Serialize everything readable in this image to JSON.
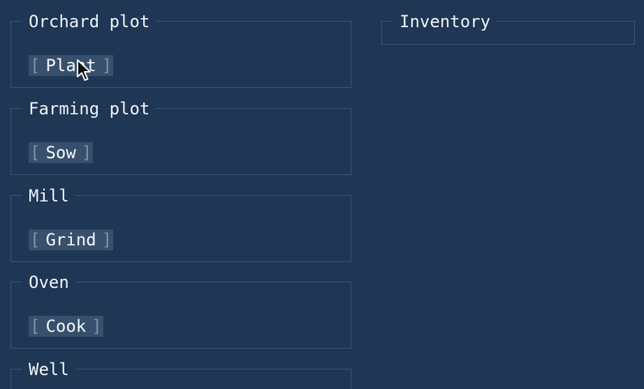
{
  "stations": [
    {
      "title": "Orchard plot",
      "action": "Plant"
    },
    {
      "title": "Farming plot",
      "action": "Sow"
    },
    {
      "title": "Mill",
      "action": "Grind"
    },
    {
      "title": "Oven",
      "action": "Cook"
    },
    {
      "title": "Well"
    }
  ],
  "inventory": {
    "title": "Inventory"
  },
  "brackets": {
    "open": "[",
    "close": "]"
  },
  "colors": {
    "background": "#1f3655",
    "border": "#3d5978",
    "button": "#37506d",
    "text": "#f2f5f8"
  }
}
